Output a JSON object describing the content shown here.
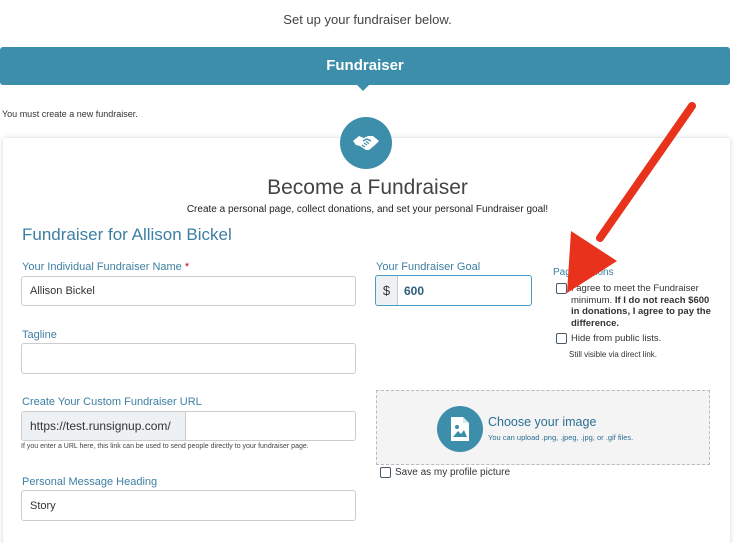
{
  "intro_text": "Set up your fundraiser below.",
  "banner": {
    "label": "Fundraiser"
  },
  "notice": "You must create a new fundraiser.",
  "card": {
    "title": "Become a Fundraiser",
    "subtitle": "Create a personal page, collect donations, and set your personal Fundraiser goal!",
    "section_title": "Fundraiser for Allison Bickel"
  },
  "form": {
    "name_label": "Your Individual Fundraiser Name",
    "name_required": "*",
    "name_value": "Allison Bickel",
    "goal_label": "Your Fundraiser Goal",
    "goal_prefix": "$",
    "goal_value": "600",
    "tagline_label": "Tagline",
    "tagline_value": "",
    "url_label": "Create Your Custom Fundraiser URL",
    "url_prefix": "https://test.runsignup.com/",
    "url_value": "",
    "url_hint": "If you enter a URL here, this link can be used to send people directly to your fundraiser page.",
    "message_heading_label": "Personal Message Heading",
    "message_heading_value": "Story"
  },
  "page_options": {
    "label": "Page Options",
    "agree_text": "I agree to meet the Fundraiser minimum.",
    "agree_bold": "If I do not reach $600 in donations, I agree to pay the difference.",
    "hide_text": "Hide from public lists.",
    "hide_note": "Still visible via direct link."
  },
  "upload": {
    "title": "Choose your image",
    "subtitle": "You can upload .png, .jpeg, .jpg, or .gif files.",
    "profile_checkbox": "Save as my profile picture"
  },
  "colors": {
    "accent": "#3d8eab",
    "link": "#3d7fa3",
    "annotation_arrow": "#e8321c"
  }
}
